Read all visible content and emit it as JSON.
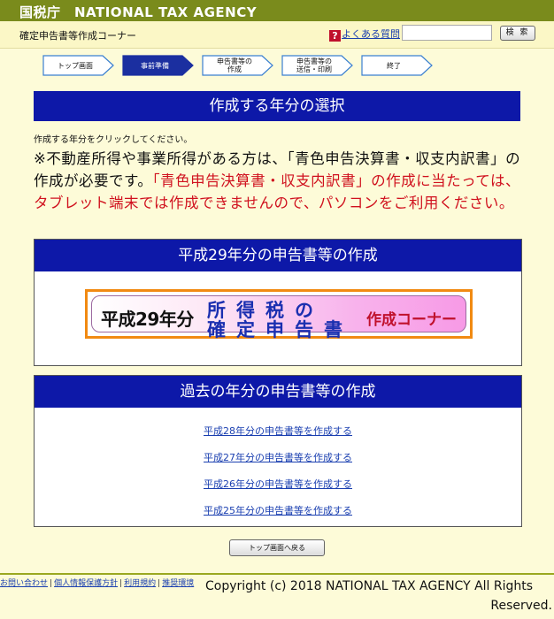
{
  "header": {
    "brand": "国税庁　NATIONAL TAX AGENCY"
  },
  "subheader": {
    "corner_name": "確定申告書等作成コーナー",
    "faq_label": "よくある質問",
    "search_placeholder": "",
    "search_button": "検 索"
  },
  "steps": [
    {
      "label": "トップ画面",
      "active": false
    },
    {
      "label": "事前準備",
      "active": true
    },
    {
      "label": "申告書等の\n作成",
      "active": false
    },
    {
      "label": "申告書等の\n送信・印刷",
      "active": false
    },
    {
      "label": "終了",
      "active": false
    }
  ],
  "page_title": "作成する年分の選択",
  "instruction": "作成する年分をクリックしてください。",
  "notice": {
    "black": "※不動産所得や事業所得がある方は、「青色申告決算書・収支内訳書」の作成が必要です。",
    "red": "「青色申告決算書・収支内訳書」の作成に当たっては、タブレット端末では作成できませんので、パソコンをご利用ください。"
  },
  "current_year_panel": {
    "heading": "平成29年分の申告書等の作成",
    "banner": {
      "year": "平成29年分",
      "line1": "所得税の",
      "line2": "確定申告書",
      "corner": "作成コーナー"
    }
  },
  "past_years_panel": {
    "heading": "過去の年分の申告書等の作成",
    "links": [
      "平成28年分の申告書等を作成する",
      "平成27年分の申告書等を作成する",
      "平成26年分の申告書等を作成する",
      "平成25年分の申告書等を作成する"
    ]
  },
  "back_button": "トップ画面へ戻る",
  "footer": {
    "links": [
      "お問い合わせ",
      "個人情報保護方針",
      "利用規約",
      "推奨環境"
    ],
    "copyright_line1": "Copyright (c) 2018 NATIONAL TAX AGENCY All Rights",
    "copyright_line2": "Reserved."
  },
  "colors": {
    "brand_green": "#7a8b1c",
    "title_blue": "#0d18a8",
    "notice_red": "#d0111e",
    "banner_orange": "#f18a12"
  }
}
